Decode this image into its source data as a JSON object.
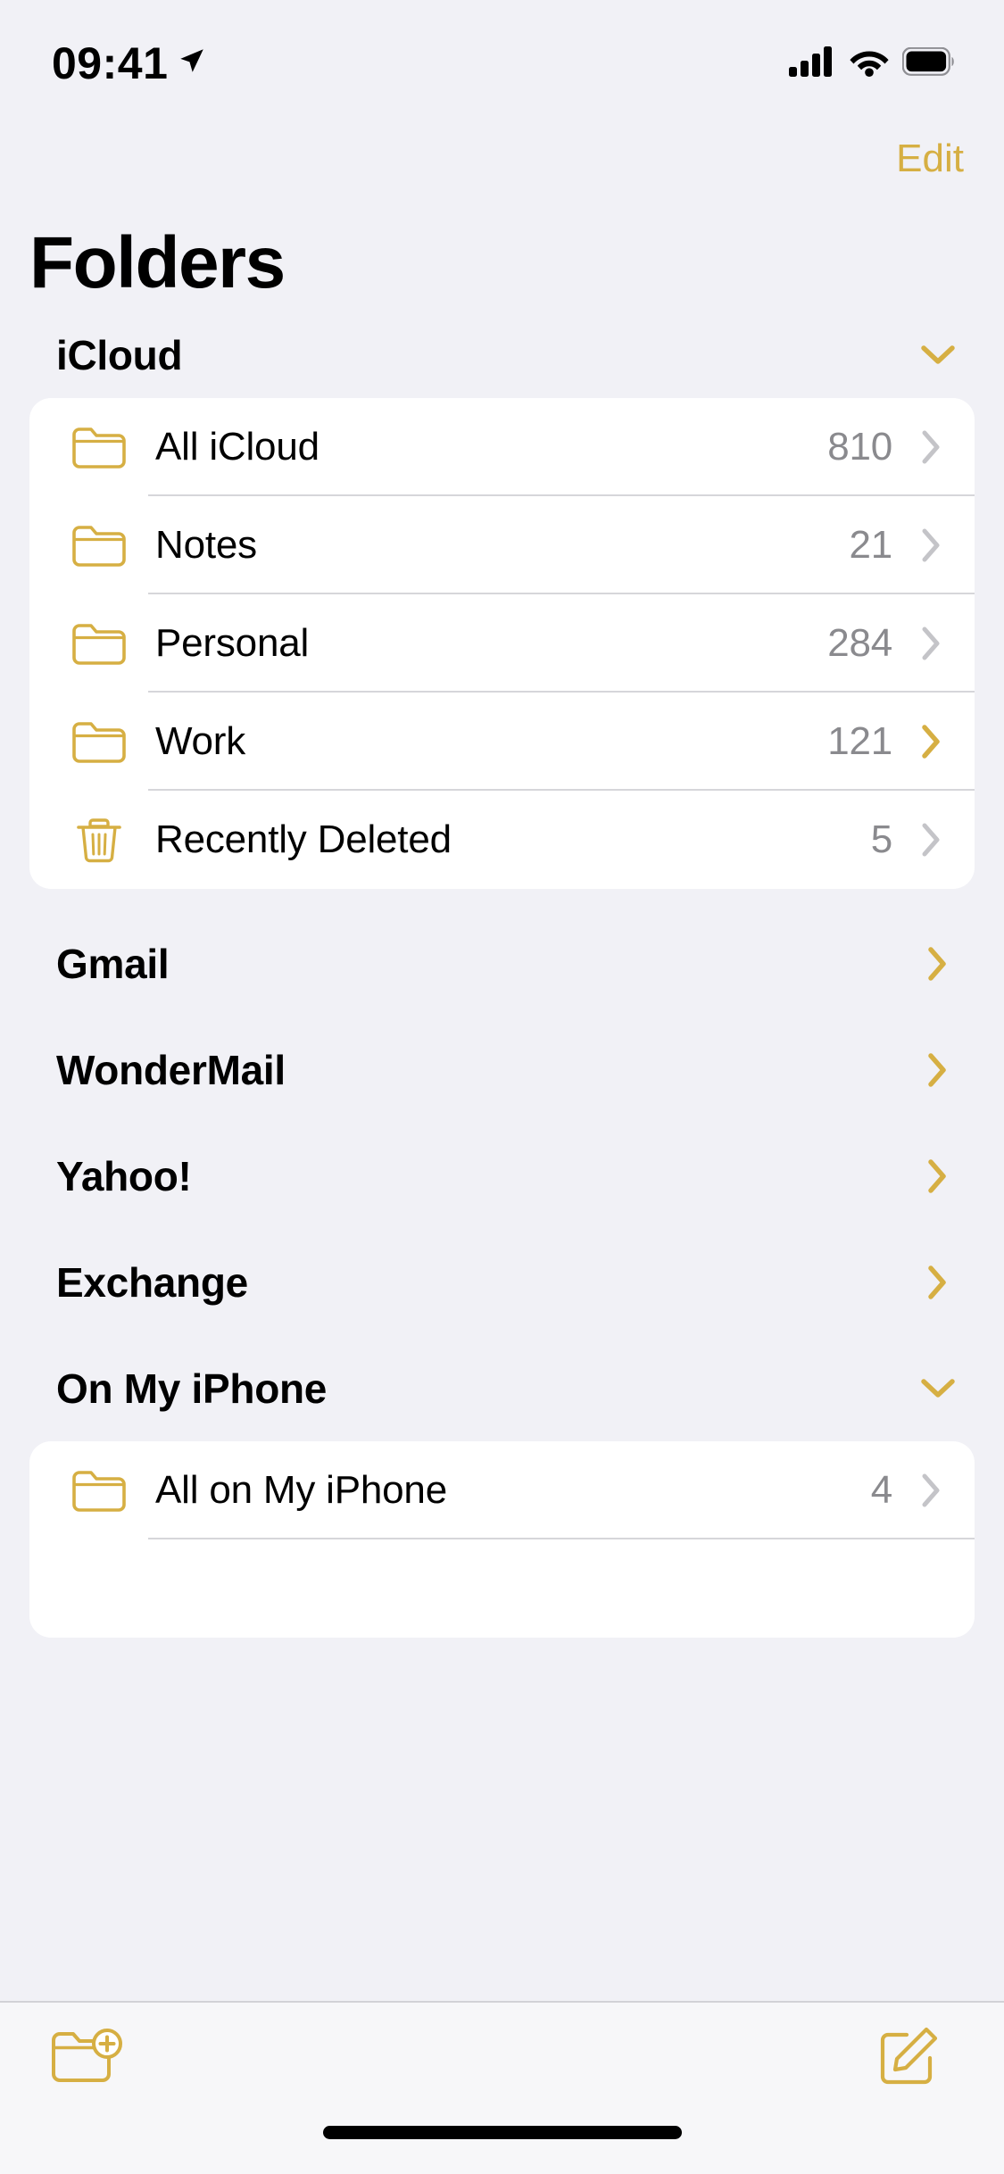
{
  "status_bar": {
    "time": "09:41",
    "location_icon": "location-arrow-icon",
    "cellular_icon": "cellular-signal-icon",
    "wifi_icon": "wifi-icon",
    "battery_icon": "battery-full-icon"
  },
  "nav": {
    "edit_label": "Edit"
  },
  "page_title": "Folders",
  "colors": {
    "accent": "#D6AF43",
    "background": "#F1F1F6",
    "card": "#FFFFFF",
    "secondary_text": "#8A8A8E",
    "separator": "#D6D6DA",
    "chevron_inactive": "#C4C4C8"
  },
  "sections": [
    {
      "name": "iCloud",
      "expanded": true,
      "chevron_icon": "chevron-down-icon",
      "rows": [
        {
          "label": "All iCloud",
          "count": "810",
          "icon": "folder-icon",
          "chevron_icon": "chevron-right-icon",
          "selected": false
        },
        {
          "label": "Notes",
          "count": "21",
          "icon": "folder-icon",
          "chevron_icon": "chevron-right-icon",
          "selected": false
        },
        {
          "label": "Personal",
          "count": "284",
          "icon": "folder-icon",
          "chevron_icon": "chevron-right-icon",
          "selected": false
        },
        {
          "label": "Work",
          "count": "121",
          "icon": "folder-icon",
          "chevron_icon": "chevron-right-icon",
          "selected": true
        },
        {
          "label": "Recently Deleted",
          "count": "5",
          "icon": "trash-icon",
          "chevron_icon": "chevron-right-icon",
          "selected": false
        }
      ]
    }
  ],
  "accounts": [
    {
      "name": "Gmail",
      "expanded": false,
      "chevron_icon": "chevron-right-icon"
    },
    {
      "name": "WonderMail",
      "expanded": false,
      "chevron_icon": "chevron-right-icon"
    },
    {
      "name": "Yahoo!",
      "expanded": false,
      "chevron_icon": "chevron-right-icon"
    },
    {
      "name": "Exchange",
      "expanded": false,
      "chevron_icon": "chevron-right-icon"
    }
  ],
  "on_my_iphone": {
    "name": "On My iPhone",
    "expanded": true,
    "chevron_icon": "chevron-down-icon",
    "rows": [
      {
        "label": "All on My iPhone",
        "count": "4",
        "icon": "folder-icon",
        "chevron_icon": "chevron-right-icon",
        "selected": false
      }
    ]
  },
  "toolbar": {
    "new_folder_icon": "new-folder-icon",
    "compose_icon": "compose-note-icon"
  }
}
